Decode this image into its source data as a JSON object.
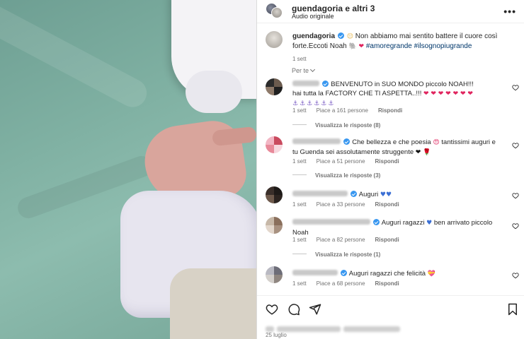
{
  "header": {
    "username": "guendagoria e altri 3",
    "audio": "Audio originale",
    "more_icon": "more-horizontal-icon"
  },
  "caption": {
    "username": "guendagoria",
    "text": "Non abbiamo mai sentito battere il cuore così forte.Eccoti Noah",
    "hashtag1": "#amoregrande",
    "hashtag2": "#ilsognopiugrande",
    "time": "1 sett"
  },
  "sort_label": "Per te",
  "comments": [
    {
      "line1": "BENVENUTO in SUO MONDO piccolo NOAH!!!",
      "line2": "hai tutta la FACTORY CHE TI ASPETTA..!!!",
      "hearts": "❤ ❤ ❤ ❤ ❤ ❤ ❤",
      "purple": "⚓⚓⚓⚓⚓⚓",
      "time": "1 sett",
      "likes": "Piace a 161 persone",
      "reply": "Rispondi",
      "view_replies": "Visualizza le risposte (8)"
    },
    {
      "text": "Che bellezza e che poesia",
      "text2": "tantissimi auguri e tu Guenda sei assolutamente struggente",
      "emoji_a": "😍",
      "emoji_b": "❤",
      "time": "1 sett",
      "likes": "Piace a 51 persone",
      "reply": "Rispondi",
      "view_replies": "Visualizza le risposte (3)"
    },
    {
      "text": "Auguri",
      "emoji": "♥♥",
      "time": "1 sett",
      "likes": "Piace a 33 persone",
      "reply": "Rispondi"
    },
    {
      "text": "Auguri ragazzi",
      "text2": "ben arrivato piccolo Noah",
      "emoji": "♥",
      "time": "1 sett",
      "likes": "Piace a 82 persone",
      "reply": "Rispondi",
      "view_replies": "Visualizza le risposte (1)"
    },
    {
      "text": "Auguri ragazzi che felicità",
      "emoji": "💝",
      "time": "1 sett",
      "likes": "Piace a 68 persone",
      "reply": "Rispondi"
    }
  ],
  "footer": {
    "date": "25 luglio"
  },
  "colors": {
    "verified": "#3897f0",
    "hashtag": "#00376b",
    "muted": "#737373"
  }
}
